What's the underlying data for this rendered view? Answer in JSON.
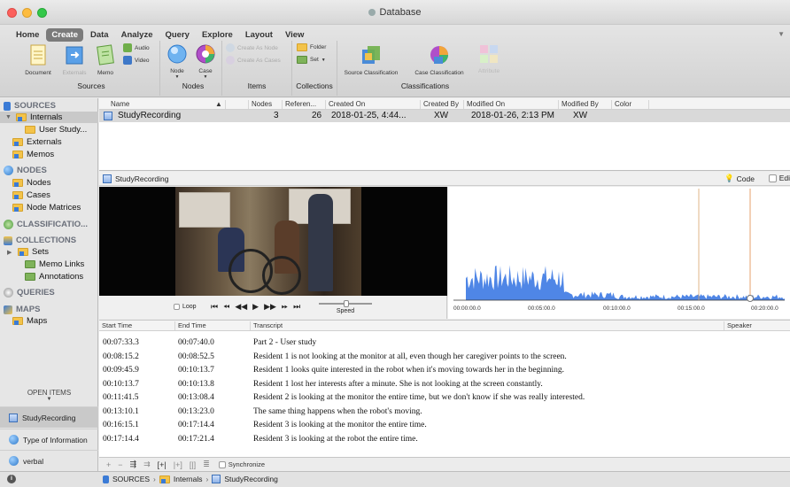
{
  "window": {
    "title": "Database"
  },
  "ribbon": {
    "tabs": [
      "Home",
      "Create",
      "Data",
      "Analyze",
      "Query",
      "Explore",
      "Layout",
      "View"
    ],
    "active_tab": "Create",
    "items": {
      "document": "Document",
      "externals": "Externals",
      "memo": "Memo",
      "audio": "Audio",
      "video": "Video",
      "node": "Node",
      "case": "Case",
      "create_as_node": "Create As Node",
      "create_as_cases": "Create As Cases",
      "folder": "Folder",
      "set": "Set",
      "source_classification": "Source Classification",
      "case_classification": "Case Classification",
      "attribute": "Attribute"
    },
    "groups": {
      "sources": "Sources",
      "nodes": "Nodes",
      "items": "Items",
      "collections": "Collections",
      "classifications": "Classifications"
    }
  },
  "sidebar": {
    "sources": "SOURCES",
    "internals": "Internals",
    "user_study": "User Study...",
    "externals": "Externals",
    "memos": "Memos",
    "nodes_head": "NODES",
    "nodes": "Nodes",
    "cases": "Cases",
    "node_matrices": "Node Matrices",
    "classifications": "CLASSIFICATIO...",
    "collections": "COLLECTIONS",
    "sets": "Sets",
    "memo_links": "Memo Links",
    "annotations": "Annotations",
    "queries": "QUERIES",
    "maps_head": "MAPS",
    "maps": "Maps",
    "open_items": "OPEN ITEMS",
    "open_list": [
      "StudyRecording",
      "Type of Information",
      "verbal"
    ]
  },
  "list": {
    "columns": [
      "Name",
      "Nodes",
      "Referen...",
      "Created On",
      "Created By",
      "Modified On",
      "Modified By",
      "Color"
    ],
    "row": {
      "name": "StudyRecording",
      "nodes": "3",
      "references": "26",
      "created_on": "2018-01-25, 4:44...",
      "created_by": "XW",
      "modified_on": "2018-01-26, 2:13 PM",
      "modified_by": "XW"
    }
  },
  "detail": {
    "title": "StudyRecording",
    "code_label": "Code",
    "edit_label": "Edi"
  },
  "player": {
    "loop_label": "Loop",
    "speed_label": "Speed",
    "timeline": [
      "00:00:00.0",
      "00:05:00.0",
      "00:10:00.0",
      "00:15:00.0",
      "00:20:00.0"
    ]
  },
  "transcript": {
    "columns": [
      "Start Time",
      "End Time",
      "Transcript",
      "Speaker"
    ],
    "rows": [
      {
        "start": "00:07:33.3",
        "end": "00:07:40.0",
        "text": "Part 2 - User study"
      },
      {
        "start": "00:08:15.2",
        "end": "00:08:52.5",
        "text": "Resident 1 is not looking at the monitor at all, even though her caregiver points to the screen."
      },
      {
        "start": "00:09:45.9",
        "end": "00:10:13.7",
        "text": "Resident 1 looks quite interested in the robot when it's moving towards her in the beginning."
      },
      {
        "start": "00:10:13.7",
        "end": "00:10:13.8",
        "text": "Resident 1 lost her interests after a minute. She is not looking at the screen constantly."
      },
      {
        "start": "00:11:41.5",
        "end": "00:13:08.4",
        "text": "Resident 2 is looking at the monitor the entire time, but we don't know if she was really interested."
      },
      {
        "start": "00:13:10.1",
        "end": "00:13:23.0",
        "text": "The same thing happens when the robot's moving."
      },
      {
        "start": "00:16:15.1",
        "end": "00:17:14.4",
        "text": "Resident 3 is looking at the monitor the entire time."
      },
      {
        "start": "00:17:14.4",
        "end": "00:17:21.4",
        "text": "Resident 3 is looking at the robot the entire time."
      }
    ]
  },
  "toolbar": {
    "synchronize": "Synchronize"
  },
  "breadcrumb": [
    "SOURCES",
    "Internals",
    "StudyRecording"
  ]
}
